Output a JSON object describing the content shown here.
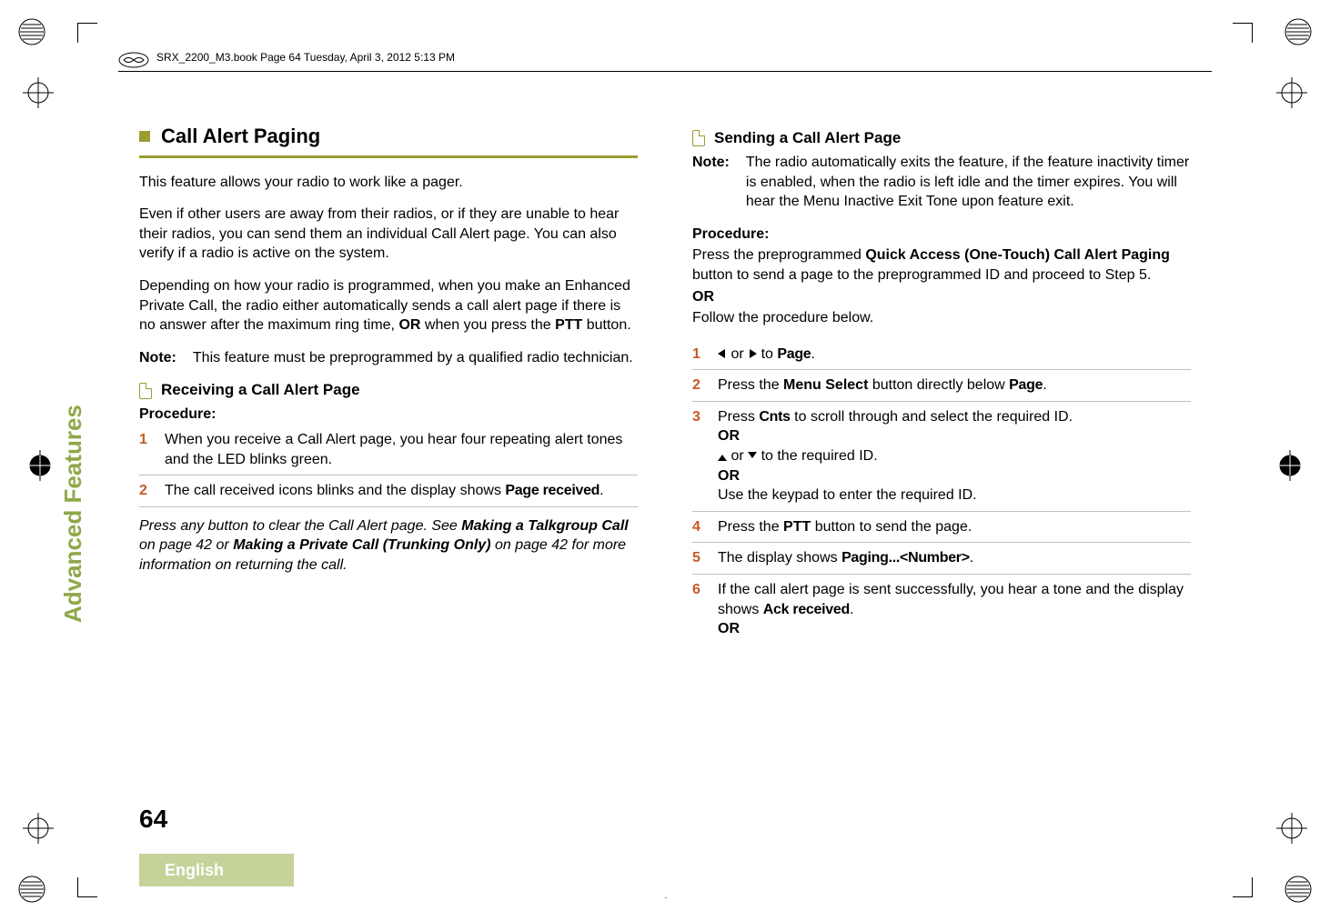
{
  "header": {
    "filename_line": "SRX_2200_M3.book  Page 64  Tuesday, April 3, 2012  5:13 PM"
  },
  "side_tab": "Advanced Features",
  "page_number": "64",
  "language": "English",
  "left": {
    "section_title": "Call Alert Paging",
    "intro_p1": "This feature allows your radio to work like a pager.",
    "intro_p2": "Even if other users are away from their radios, or if they are unable to hear their radios, you can send them an individual Call Alert page. You can also verify if a radio is active on the system.",
    "intro_p3a": "Depending on how your radio is programmed, when you make an Enhanced Private Call, the radio either automatically sends a call alert page if there is no answer after the maximum ring time, ",
    "intro_p3_or": "OR",
    "intro_p3b": " when you press the ",
    "intro_p3_ptt": "PTT",
    "intro_p3c": " button.",
    "note_label": "Note:",
    "note_text": "This feature must be preprogrammed by a qualified radio technician.",
    "sub1_title": "Receiving a Call Alert Page",
    "procedure_label": "Procedure:",
    "step1": "When you receive a Call Alert page, you hear four repeating alert tones and the LED blinks green.",
    "step2a": "The call received icons blinks and the display shows ",
    "step2_radio": "Page received",
    "step2b": ".",
    "italic_1a": "Press any button to clear the Call Alert page. See ",
    "italic_b1": "Making a Talkgroup Call",
    "italic_1b": " on page 42 or ",
    "italic_b2": "Making a Private Call (Trunking Only)",
    "italic_1c": " on page 42 for more information on returning the call."
  },
  "right": {
    "sub2_title": "Sending a Call Alert Page",
    "note_label": "Note:",
    "note_text": "The radio automatically exits the feature, if the feature inactivity timer is enabled, when the radio is left idle and the timer expires. You will hear the Menu Inactive Exit Tone upon feature exit.",
    "procedure_label": "Procedure:",
    "preamble_a": "Press the preprogrammed ",
    "preamble_b": "Quick Access (One-Touch) Call Alert Paging",
    "preamble_c": " button to send a page to the preprogrammed ID and proceed to Step 5.",
    "or1": "OR",
    "preamble_d": "Follow the procedure below.",
    "s1_a": " or ",
    "s1_b": " to ",
    "s1_radio": "Page",
    "s1_c": ".",
    "s2_a": "Press the ",
    "s2_b": "Menu Select",
    "s2_c": " button directly below ",
    "s2_radio": "Page",
    "s2_d": ".",
    "s3_a": "Press ",
    "s3_radio": "Cnts",
    "s3_b": " to scroll through and select the required ID.",
    "s3_or1": "OR",
    "s3_c": " or ",
    "s3_d": " to the required ID.",
    "s3_or2": "OR",
    "s3_e": "Use the keypad to enter the required ID.",
    "s4_a": "Press the ",
    "s4_b": "PTT",
    "s4_c": " button to send the page.",
    "s5_a": "The display shows ",
    "s5_radio": "Paging...<Number>",
    "s5_b": ".",
    "s6_a": "If the call alert page is sent successfully, you hear a tone and the display shows ",
    "s6_radio": "Ack received",
    "s6_b": ".",
    "s6_or": "OR"
  }
}
